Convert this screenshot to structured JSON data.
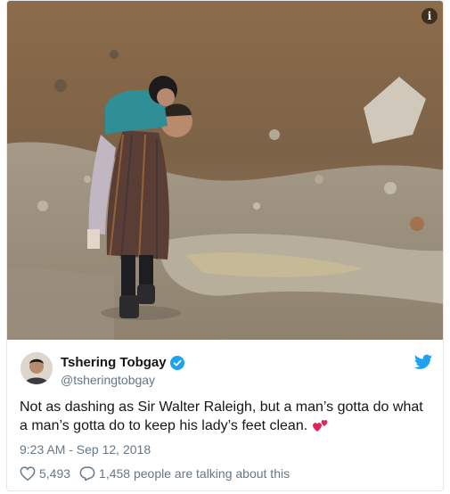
{
  "media": {
    "info_icon": "info-icon",
    "info_glyph": "i"
  },
  "author": {
    "display_name": "Tshering Tobgay",
    "handle": "@tsheringtobgay",
    "verified": true,
    "verified_color": "#1da1f2"
  },
  "platform_icon": "twitter-bird-icon",
  "brand_color": "#1da1f2",
  "tweet": {
    "text": "Not as dashing as Sir Walter Raleigh, but a man’s gotta do what a man’s gotta do to keep his lady’s feet clean.",
    "emoji": "two-hearts-emoji",
    "timestamp": "9:23 AM - Sep 12, 2018"
  },
  "engagement": {
    "likes": "5,493",
    "talking": "1,458 people are talking about this"
  }
}
